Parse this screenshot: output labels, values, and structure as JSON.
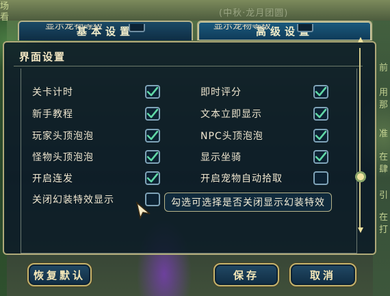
{
  "tabs": {
    "basic": "基本设置",
    "advanced": "高级设置"
  },
  "panel": {
    "title": "界面设置"
  },
  "cut_row": {
    "left_label": "显示宠物等级",
    "right_label": "显示宠物等级"
  },
  "options": [
    {
      "label": "关卡计时",
      "checked": true
    },
    {
      "label": "即时评分",
      "checked": true
    },
    {
      "label": "新手教程",
      "checked": true
    },
    {
      "label": "文本立即显示",
      "checked": true
    },
    {
      "label": "玩家头顶泡泡",
      "checked": true
    },
    {
      "label": "NPC头顶泡泡",
      "checked": true
    },
    {
      "label": "怪物头顶泡泡",
      "checked": true
    },
    {
      "label": "显示坐骑",
      "checked": true
    },
    {
      "label": "开启连发",
      "checked": true
    },
    {
      "label": "开启宠物自动拾取",
      "checked": false
    },
    {
      "label": "关闭幻装特效显示",
      "checked": false
    }
  ],
  "tooltip": "勾选可选择是否关闭显示幻装特效",
  "buttons": {
    "reset": "恢复默认",
    "save": "保存",
    "cancel": "取消"
  },
  "background": {
    "top_text": "(中秋·龙月团圆)",
    "left_chars": [
      "场",
      "看"
    ],
    "right_chars": [
      "前",
      "用",
      "那",
      "准",
      "在",
      "肆",
      "引",
      "在",
      "打"
    ]
  },
  "colors": {
    "check": "#5fd7a5",
    "accent_border": "#b7b48a"
  }
}
